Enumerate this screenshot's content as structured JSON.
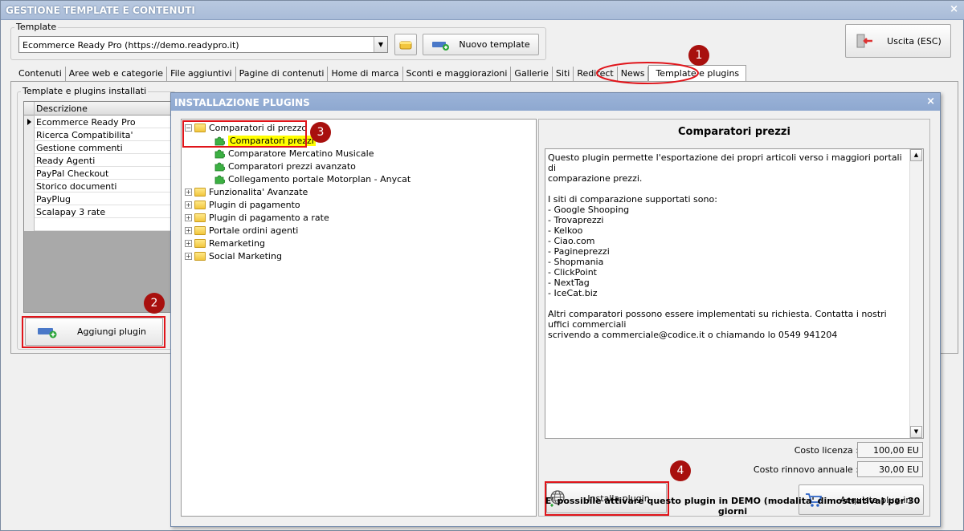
{
  "window": {
    "title": "GESTIONE TEMPLATE E CONTENUTI",
    "close_glyph": "×"
  },
  "template_group": {
    "legend": "Template",
    "selected": "Ecommerce Ready Pro (https://demo.readypro.it)",
    "new_button": "Nuovo template"
  },
  "exit_button": "Uscita (ESC)",
  "tabs": [
    "Contenuti",
    "Aree web e categorie",
    "File aggiuntivi",
    "Pagine di contenuti",
    "Home di marca",
    "Sconti e maggiorazioni",
    "Gallerie",
    "Siti",
    "Redirect",
    "News",
    "Template e plugins"
  ],
  "installed": {
    "legend": "Template e plugins installati",
    "column": "Descrizione",
    "rows": [
      "Ecommerce Ready Pro",
      "Ricerca Compatibilita'",
      "Gestione commenti",
      "Ready Agenti",
      "PayPal Checkout",
      "Storico documenti",
      "PayPlug",
      "Scalapay 3 rate",
      ""
    ],
    "add_button": "Aggiungi plugin"
  },
  "dialog": {
    "title": "INSTALLAZIONE PLUGINS",
    "close_glyph": "×",
    "tree": {
      "expanded": {
        "label": "Comparatori di prezzo",
        "toggle": "−",
        "children": [
          "Comparatori prezzi",
          "Comparatore Mercatino Musicale",
          "Comparatori prezzi avanzato",
          "Collegamento portale Motorplan - Anycat"
        ]
      },
      "collapsed_toggle": "+",
      "collapsed": [
        "Funzionalita' Avanzate",
        "Plugin di pagamento",
        "Plugin di pagamento a rate",
        "Portale ordini agenti",
        "Remarketing",
        "Social Marketing"
      ]
    },
    "detail": {
      "title": "Comparatori prezzi",
      "description": "Questo plugin permette l'esportazione dei propri articoli verso i maggiori portali di\ncomparazione prezzi.\n\nI siti di comparazione supportati sono:\n- Google Shooping\n- Trovaprezzi\n- Kelkoo\n- Ciao.com\n- Pagineprezzi\n- Shopmania\n- ClickPoint\n- NextTag\n- IceCat.biz\n\nAltri comparatori possono essere implementati su richiesta. Contatta i nostri uffici commerciali\nscrivendo a commerciale@codice.it o chiamando lo 0549 941204",
      "license_label": "Costo licenza :",
      "license_value": "100,00 EU",
      "renewal_label": "Costo rinnovo annuale :",
      "renewal_value": "30,00 EU",
      "install_button": "Installa plugin",
      "buy_button": "Acquista plug-in",
      "demo_note": "E' possibile attivare questo plugin in DEMO (modalita' dimostrativa) per 30 giorni"
    }
  },
  "callouts": [
    "1",
    "2",
    "3",
    "4"
  ],
  "colors": {
    "callout": "#a8100e",
    "highlight_box": "#e0141a",
    "selected_node": "#ffff00",
    "titlebar": "#a9bcd8"
  }
}
